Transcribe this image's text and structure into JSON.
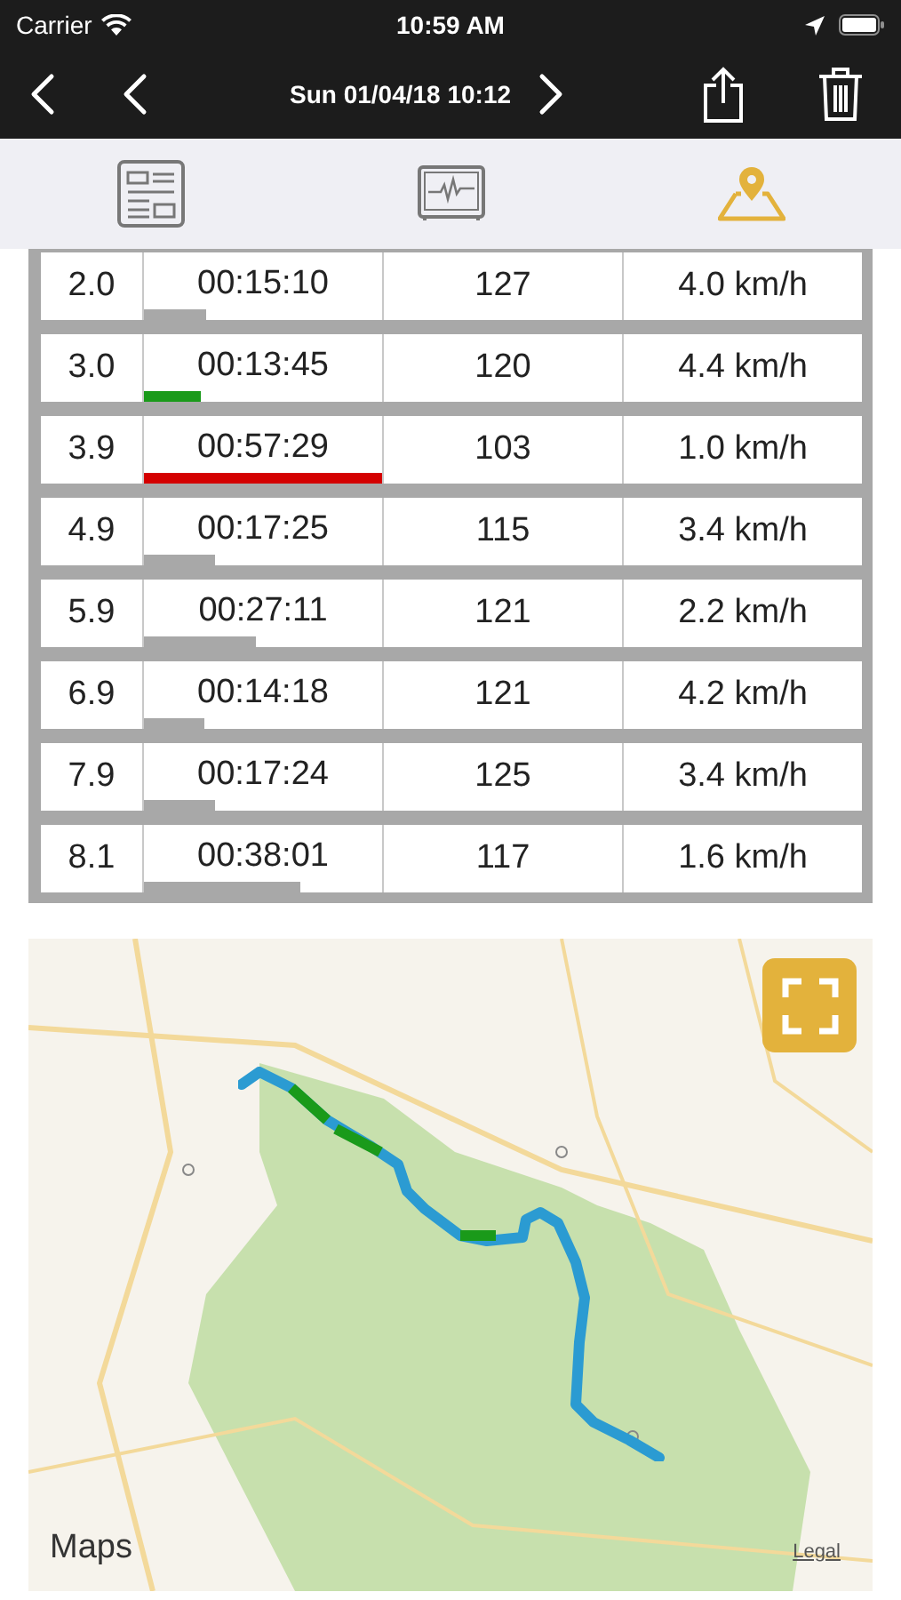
{
  "status_bar": {
    "carrier": "Carrier",
    "time": "10:59 AM"
  },
  "nav_bar": {
    "title": "Sun 01/04/18 10:12"
  },
  "tabs": [
    {
      "kind": "summary",
      "selected": false
    },
    {
      "kind": "chart",
      "selected": false
    },
    {
      "kind": "map",
      "selected": true
    }
  ],
  "table": {
    "rows": [
      {
        "distance": "2.0",
        "time": "00:15:10",
        "level": 0.26,
        "color": "#a8a8a8",
        "count": "127",
        "speed": "4.0 km/h"
      },
      {
        "distance": "3.0",
        "time": "00:13:45",
        "level": 0.24,
        "color": "#1a9a1a",
        "count": "120",
        "speed": "4.4 km/h"
      },
      {
        "distance": "3.9",
        "time": "00:57:29",
        "level": 1.0,
        "color": "#d40000",
        "count": "103",
        "speed": "1.0 km/h"
      },
      {
        "distance": "4.9",
        "time": "00:17:25",
        "level": 0.3,
        "color": "#a8a8a8",
        "count": "115",
        "speed": "3.4 km/h"
      },
      {
        "distance": "5.9",
        "time": "00:27:11",
        "level": 0.47,
        "color": "#a8a8a8",
        "count": "121",
        "speed": "2.2 km/h"
      },
      {
        "distance": "6.9",
        "time": "00:14:18",
        "level": 0.25,
        "color": "#a8a8a8",
        "count": "121",
        "speed": "4.2 km/h"
      },
      {
        "distance": "7.9",
        "time": "00:17:24",
        "level": 0.3,
        "color": "#a8a8a8",
        "count": "125",
        "speed": "3.4 km/h"
      },
      {
        "distance": "8.1",
        "time": "00:38:01",
        "level": 0.66,
        "color": "#a8a8a8",
        "count": "117",
        "speed": "1.6 km/h"
      }
    ]
  },
  "map": {
    "kind": "picture",
    "logo": "Maps",
    "legal": "Legal"
  }
}
